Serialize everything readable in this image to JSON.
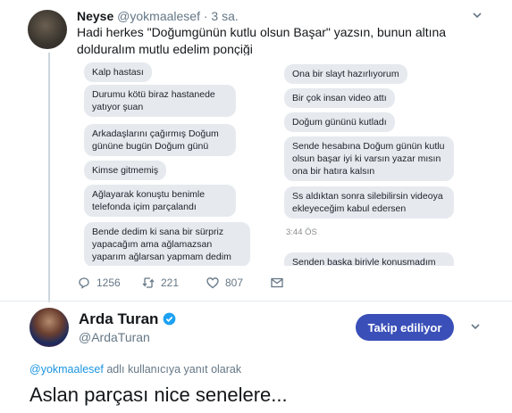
{
  "tweet1": {
    "display_name": "Neyse",
    "handle": "@yokmaalesef",
    "time": "· 3 sa.",
    "text": "Hadi herkes \"Doğumgünün kutlu olsun Başar\" yazsın, bunun altına dolduralım mutlu edelim ponçiği",
    "chat_left": [
      "Kalp hastası",
      "Durumu kötü biraz hastanede yatıyor şuan",
      "Arkadaşlarını çağırmış Doğum gününe bugün Doğum günü",
      "Kimse gitmemiş",
      "Ağlayarak konuştu benimle telefonda içim parçalandı",
      "Bende dedim ki sana bir sürpriz yapacağım ama ağlamazsan yaparım ağlarsan yapmam dedim"
    ],
    "chat_right": [
      "Ona bir slayt hazırlıyorum",
      "Bir çok insan video attı",
      "Doğum gününü kutladı",
      "Sende hesabına Doğum günün kutlu olsun başar iyi ki varsın yazar mısın ona bir hatıra kalsın",
      "Ss aldıktan sonra silebilirsin videoya ekleyeceğim kabul edersen",
      "Senden baska birivle konusmadım"
    ],
    "chat_time": "3:44 ÖS",
    "stats": {
      "replies": "1256",
      "retweets": "221",
      "likes": "807"
    }
  },
  "tweet2": {
    "display_name": "Arda Turan",
    "handle": "@ArdaTuran",
    "follow_label": "Takip ediliyor",
    "reply_mention": "@yokmaalesef",
    "reply_suffix": " adlı kullanıcıya yanıt olarak",
    "text": "Aslan parçası nice senelere..."
  },
  "colors": {
    "link": "#1b95e0",
    "verified": "#1da1f2",
    "follow_button": "#3a4fb8",
    "secondary_text": "#657786"
  },
  "icons": [
    "chevron-down-icon",
    "reply-icon",
    "retweet-icon",
    "like-icon",
    "dm-icon",
    "verified-icon"
  ]
}
